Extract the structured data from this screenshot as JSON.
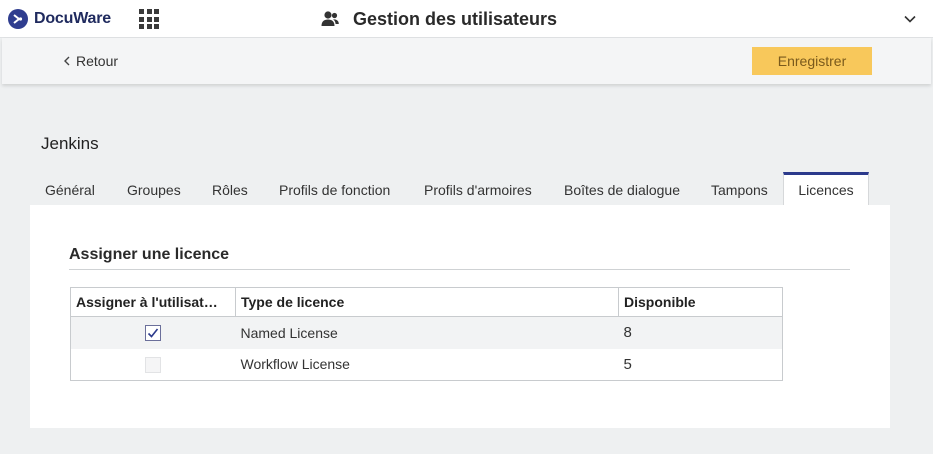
{
  "app": {
    "brand": "DocuWare",
    "title": "Gestion des utilisateurs",
    "title_icon": "users-icon"
  },
  "toolbar": {
    "back_label": "Retour",
    "save_label": "Enregistrer"
  },
  "user": {
    "name": "Jenkins"
  },
  "tabs": [
    {
      "label": "Général"
    },
    {
      "label": "Groupes"
    },
    {
      "label": "Rôles"
    },
    {
      "label": "Profils de fonction"
    },
    {
      "label": "Profils d'armoires"
    },
    {
      "label": "Boîtes de dialogue"
    },
    {
      "label": "Tampons"
    },
    {
      "label": "Licences",
      "active": true
    }
  ],
  "section": {
    "heading": "Assigner une licence",
    "columns": [
      "Assigner à l'utilisat…",
      "Type de licence",
      "Disponible"
    ],
    "rows": [
      {
        "assigned": true,
        "enabled": true,
        "type": "Named License",
        "available": "8"
      },
      {
        "assigned": false,
        "enabled": false,
        "type": "Workflow License",
        "available": "5"
      }
    ]
  },
  "colors": {
    "accent": "#2c3a8c",
    "save_button": "#f8c85b",
    "background": "#eef0f1"
  }
}
